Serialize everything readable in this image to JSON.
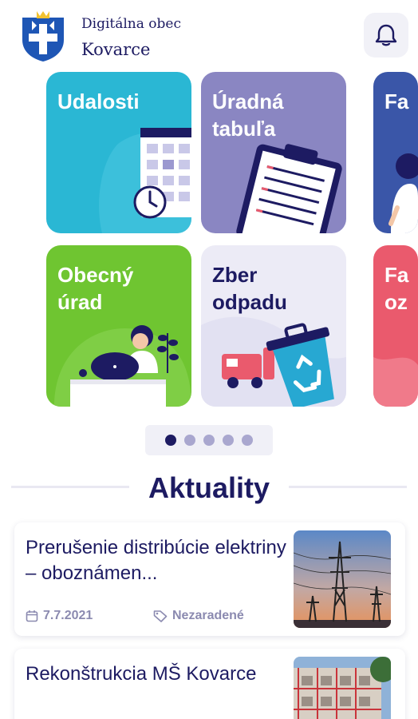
{
  "header": {
    "line1": "Digitálna obec",
    "line2": "Kovarce",
    "crest_icon": "coat-of-arms-icon",
    "bell_icon": "bell-icon"
  },
  "tiles": [
    {
      "title": "Udalosti",
      "icon": "calendar-clock-icon"
    },
    {
      "title": "Úradná\ntabuľa",
      "icon": "clipboard-icon"
    },
    {
      "title": "Fa"
    },
    {
      "title": "Obecný\núrad",
      "icon": "office-worker-icon"
    },
    {
      "title": "Zber\nodpadu",
      "icon": "recycling-truck-icon"
    },
    {
      "title": "Fa\noz"
    }
  ],
  "carousel": {
    "pages": 5,
    "active": 1
  },
  "section": {
    "title": "Aktuality"
  },
  "news": [
    {
      "title": "Prerušenie distribúcie elektriny – oboznámen...",
      "date": "7.7.2021",
      "tag": "Nezaradené",
      "thumb": "power-lines-image"
    },
    {
      "title": "Rekonštrukcia MŠ Kovarce",
      "thumb": "building-scaffold-image"
    }
  ],
  "colors": {
    "navy": "#1d1b62",
    "udalosti": "#2ab7d4",
    "tabula": "#8a86c2",
    "urad": "#6fc531",
    "zber": "#ecebf6",
    "fara": "#3a56a8",
    "pink": "#ea5a6d"
  }
}
